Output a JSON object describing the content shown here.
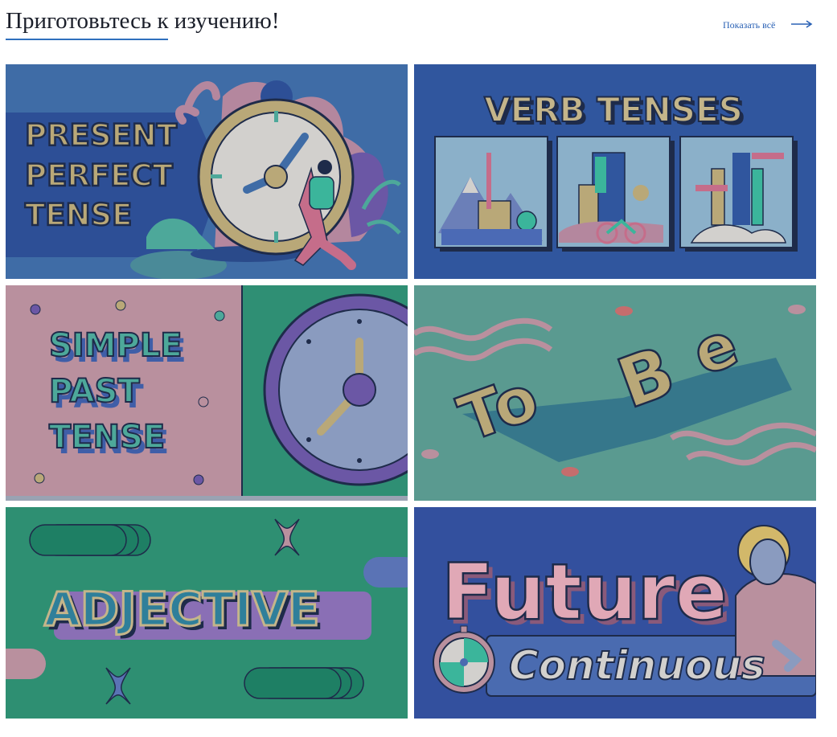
{
  "header": {
    "title": "Приготовьтесь к изучению!",
    "show_all_label": "Показать всё"
  },
  "colors": {
    "accent": "#2f6fbd",
    "link": "#2b62b5",
    "title": "#1b1f2a"
  },
  "cards": [
    {
      "lines": [
        "PRESENT",
        "PERFECT",
        "TENSE"
      ]
    },
    {
      "lines": [
        "VERB TENSES"
      ]
    },
    {
      "lines": [
        "SIMPLE",
        "PAST",
        "TENSE"
      ]
    },
    {
      "lines": [
        "To",
        "B",
        "e"
      ]
    },
    {
      "lines": [
        "ADJECTIVE"
      ]
    },
    {
      "lines": [
        "Future",
        "Continuous"
      ]
    }
  ]
}
